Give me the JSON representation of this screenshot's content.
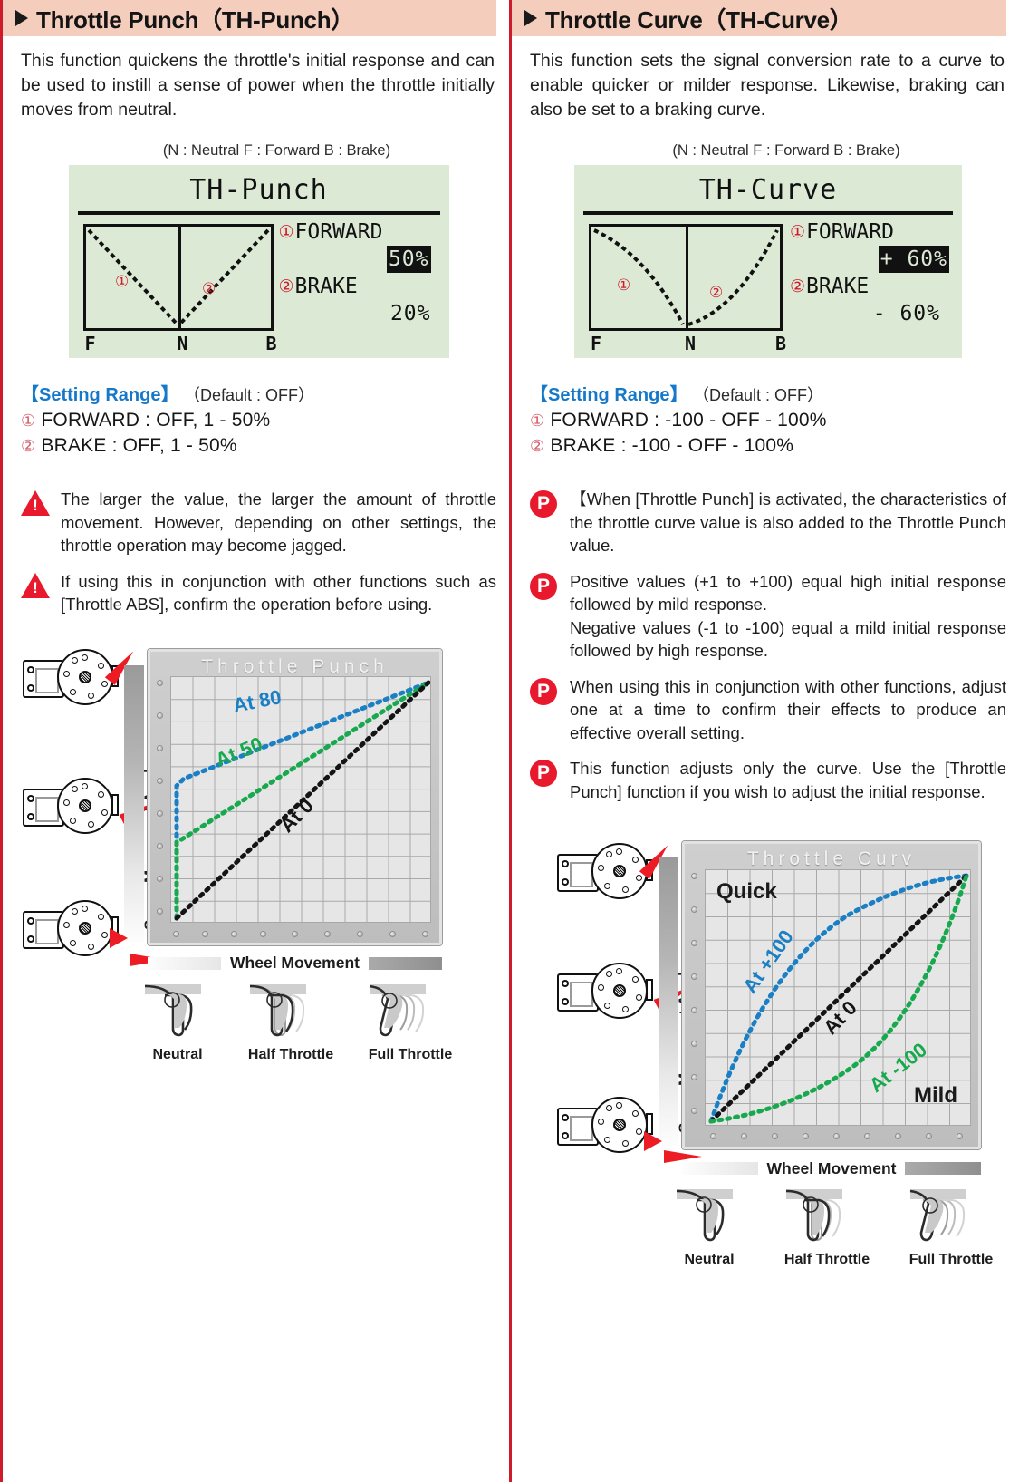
{
  "left": {
    "header": {
      "icon": "triangle-right-icon",
      "title": "Throttle Punch（TH-Punch）"
    },
    "intro": "This function quickens the throttle's initial response and can be used to instill a sense of power when the throttle initially moves from neutral.",
    "lcd": {
      "legend": "(N : Neutral   F : Forward   B : Brake)",
      "title": "TH-Punch",
      "axis": {
        "f": "F",
        "n": "N",
        "b": "B"
      },
      "rows": [
        {
          "num": "①",
          "label": "FORWARD",
          "value": "50%",
          "highlighted": true
        },
        {
          "num": "②",
          "label": "BRAKE",
          "value": "20%",
          "highlighted": false
        }
      ]
    },
    "settings": {
      "heading": "【Setting Range】",
      "default": "（Default : OFF）",
      "lines": [
        {
          "num": "①",
          "text": "FORWARD : OFF, 1 - 50%"
        },
        {
          "num": "②",
          "text": "BRAKE : OFF, 1 - 50%"
        }
      ]
    },
    "notes": [
      {
        "icon": "warning-icon",
        "text": "The larger the value, the larger the amount of throttle movement. However, depending on other settings, the throttle operation may become jagged."
      },
      {
        "icon": "warning-icon",
        "text": "If using this in conjunction with other functions such as [Throttle ABS], confirm the operation before using."
      }
    ],
    "chart_data": {
      "type": "line",
      "title": "Throttle  Punch",
      "xlabel": "Wheel Movement",
      "ylabel": "Servo Movement Angle",
      "xlim": [
        0,
        100
      ],
      "ylim": [
        0,
        100
      ],
      "grid": true,
      "series": [
        {
          "name": "At 80",
          "color": "#1a7fc4",
          "style": "dotted",
          "points": [
            [
              0,
              0
            ],
            [
              0,
              47
            ],
            [
              10,
              52
            ],
            [
              100,
              100
            ]
          ]
        },
        {
          "name": "At 50",
          "color": "#18a84e",
          "style": "dotted",
          "points": [
            [
              0,
              0
            ],
            [
              0,
              30
            ],
            [
              2,
              31
            ],
            [
              100,
              100
            ]
          ]
        },
        {
          "name": "At 0",
          "color": "#141414",
          "style": "dotted",
          "points": [
            [
              0,
              0
            ],
            [
              100,
              100
            ]
          ]
        }
      ],
      "trigger_states": [
        "Neutral",
        "Half Throttle",
        "Full Throttle"
      ]
    }
  },
  "right": {
    "header": {
      "icon": "triangle-right-icon",
      "title": "Throttle Curve（TH-Curve）"
    },
    "intro": "This function sets the signal conversion rate to a curve to enable quicker or milder response. Likewise, braking can also be set to a braking curve.",
    "lcd": {
      "legend": "(N : Neutral   F : Forward   B : Brake)",
      "title": "TH-Curve",
      "axis": {
        "f": "F",
        "n": "N",
        "b": "B"
      },
      "rows": [
        {
          "num": "①",
          "label": "FORWARD",
          "value": "+ 60%",
          "highlighted": true
        },
        {
          "num": "②",
          "label": "BRAKE",
          "value": "- 60%",
          "highlighted": false
        }
      ]
    },
    "settings": {
      "heading": "【Setting Range】",
      "default": "（Default : OFF）",
      "lines": [
        {
          "num": "①",
          "text": "FORWARD : -100 - OFF - 100%"
        },
        {
          "num": "②",
          "text": "BRAKE : -100 - OFF - 100%"
        }
      ]
    },
    "notes": [
      {
        "icon": "point-icon",
        "text": "【When [Throttle Punch] is activated, the characteristics of the throttle curve value is also added to the Throttle Punch value."
      },
      {
        "icon": "point-icon",
        "text": "Positive values (+1 to +100) equal high initial response followed by mild response.\nNegative values (-1 to -100) equal a mild initial response followed by high response."
      },
      {
        "icon": "point-icon",
        "text": "When using this in conjunction with other functions, adjust one at a time to confirm their effects to produce an effective overall setting."
      },
      {
        "icon": "point-icon",
        "text": "This function adjusts only the curve. Use the [Throttle Punch] function if you wish to adjust the initial response."
      }
    ],
    "chart_data": {
      "type": "line",
      "title": "Throttle  Curv",
      "xlabel": "Wheel Movement",
      "ylabel": "Servo Movement Angle",
      "quick_label": "Quick",
      "mild_label": "Mild",
      "xlim": [
        0,
        100
      ],
      "ylim": [
        0,
        100
      ],
      "grid": true,
      "series": [
        {
          "name": "At +100",
          "color": "#1a7fc4",
          "style": "dotted",
          "curve": "expo-positive"
        },
        {
          "name": "At 0",
          "color": "#141414",
          "style": "dotted",
          "curve": "linear"
        },
        {
          "name": "At -100",
          "color": "#18a84e",
          "style": "dotted",
          "curve": "expo-negative"
        }
      ],
      "trigger_states": [
        "Neutral",
        "Half Throttle",
        "Full Throttle"
      ]
    }
  },
  "badges": {
    "point": "P"
  }
}
